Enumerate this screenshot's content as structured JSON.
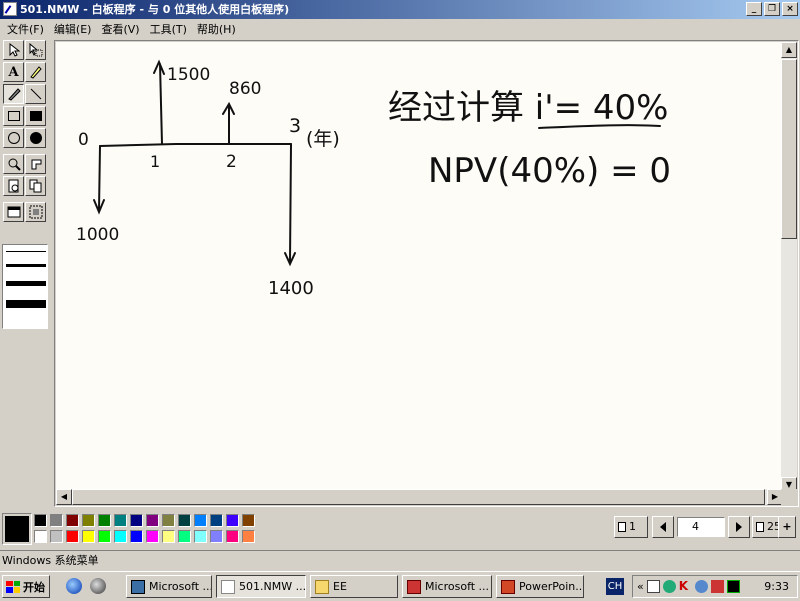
{
  "window": {
    "title": "501.NMW - 白板程序 - 与 0 位其他人使用白板程序)",
    "min_label": "_",
    "max_label": "❐",
    "close_label": "×"
  },
  "menu": [
    "文件(F)",
    "编辑(E)",
    "查看(V)",
    "工具(T)",
    "帮助(H)"
  ],
  "tools": [
    "select-arrow-icon",
    "select-area-icon",
    "text-tool-icon",
    "highlighter-icon",
    "pen-icon",
    "line-icon",
    "rectangle-outline-icon",
    "rectangle-filled-icon",
    "ellipse-outline-icon",
    "ellipse-filled-icon",
    "zoom-icon",
    "remote-pointer-icon",
    "lock-contents-icon",
    "synchronize-icon",
    "select-window-icon",
    "select-area-capture-icon"
  ],
  "whiteboard": {
    "cashflow": {
      "time_labels": [
        "0",
        "1",
        "2",
        "3"
      ],
      "unit_label": "(年)",
      "inflow_1": "1500",
      "inflow_2": "860",
      "outflow_0": "1000",
      "outflow_3": "1400"
    },
    "equation_1": "经过计算 i'= 40%",
    "equation_2": "NPV(40%) = 0"
  },
  "palette": {
    "current_color": "#000000",
    "colors": [
      "#000000",
      "#808080",
      "#800000",
      "#808000",
      "#008000",
      "#008080",
      "#000080",
      "#800080",
      "#808040",
      "#004040",
      "#0080ff",
      "#004080",
      "#4000ff",
      "#804000",
      "#ffffff",
      "#c0c0c0",
      "#ff0000",
      "#ffff00",
      "#00ff00",
      "#00ffff",
      "#0000ff",
      "#ff00ff",
      "#ffff80",
      "#00ff80",
      "#80ffff",
      "#8080ff",
      "#ff0080",
      "#ff8040"
    ]
  },
  "pagenav": {
    "first_label": "1",
    "current_page": "4",
    "last_label": "25"
  },
  "status": "Windows 系统菜单",
  "taskbar": {
    "start_label": "开始",
    "tasks": [
      "Microsoft ...",
      "501.NMW ...",
      "EE",
      "Microsoft ...",
      "PowerPoin..."
    ],
    "lang": "CH",
    "clock": "9:33"
  }
}
